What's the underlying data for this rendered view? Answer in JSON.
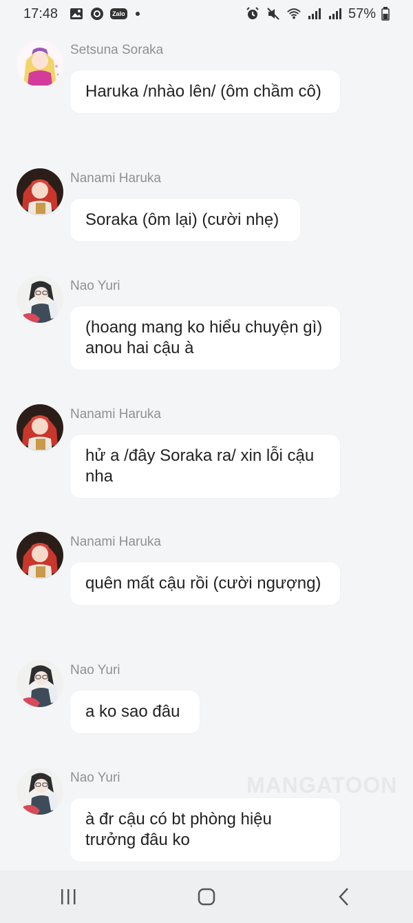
{
  "status_bar": {
    "time": "17:48",
    "zalo_label": "Zalo",
    "battery": "57%"
  },
  "messages": [
    {
      "sender": "Setsuna Soraka",
      "text": "Haruka /nhào lên/ (ôm chầm cô)",
      "avatar": "avatar-setsuna"
    },
    {
      "sender": "Nanami Haruka",
      "text": "Soraka (ôm lại) (cười nhẹ)",
      "avatar": "avatar-nanami"
    },
    {
      "sender": "Nao Yuri",
      "text": "(hoang mang ko hiểu chuyện gì) anou hai cậu à",
      "avatar": "avatar-nao"
    },
    {
      "sender": "Nanami Haruka",
      "text": "hử a /đây Soraka ra/ xin lỗi cậu nha",
      "avatar": "avatar-nanami"
    },
    {
      "sender": "Nanami Haruka",
      "text": "quên mất cậu rồi (cười ngượng)",
      "avatar": "avatar-nanami"
    },
    {
      "sender": "Nao Yuri",
      "text": "a ko sao đâu",
      "avatar": "avatar-nao"
    },
    {
      "sender": "Nao Yuri",
      "text": "à đr cậu có bt phòng hiệu trưởng đâu ko",
      "avatar": "avatar-nao"
    }
  ],
  "watermark": "MANGATOON",
  "nav": {
    "icons": [
      "recent-apps-icon",
      "home-icon",
      "back-icon"
    ]
  }
}
